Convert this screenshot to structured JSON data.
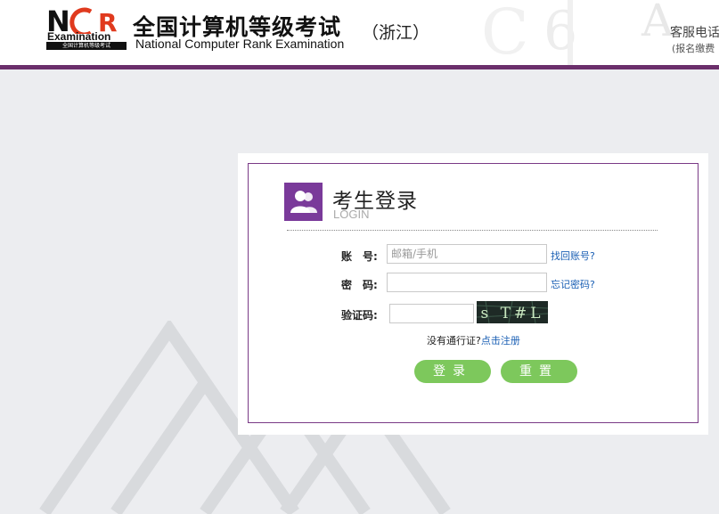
{
  "header": {
    "logo_text": "NCR",
    "logo_sub": "Examination",
    "logo_caption": "全国计算机等级考试",
    "title_cn": "全国计算机等级考试",
    "title_en": "National Computer Rank Examination",
    "province": "（浙江）",
    "service": "客服电话",
    "service_sub": "(报名缴费"
  },
  "login": {
    "title": "考生登录",
    "subtitle": "LOGIN",
    "account_label": "账　号:",
    "account_placeholder": "邮箱/手机",
    "account_value": "",
    "forgot_account": "找回账号?",
    "password_label": "密　码:",
    "password_value": "",
    "forgot_password": "忘记密码?",
    "captcha_label": "验证码:",
    "captcha_value": "",
    "captcha_text": "s T#L",
    "no_pass_text": "没有通行证?",
    "register_link": "点击注册",
    "login_button": "登录",
    "reset_button": "重置"
  },
  "colors": {
    "accent_purple": "#7a3a86",
    "header_bar": "#6b2f6b",
    "button_green": "#7dc85c",
    "link_blue": "#1a5fb4"
  }
}
